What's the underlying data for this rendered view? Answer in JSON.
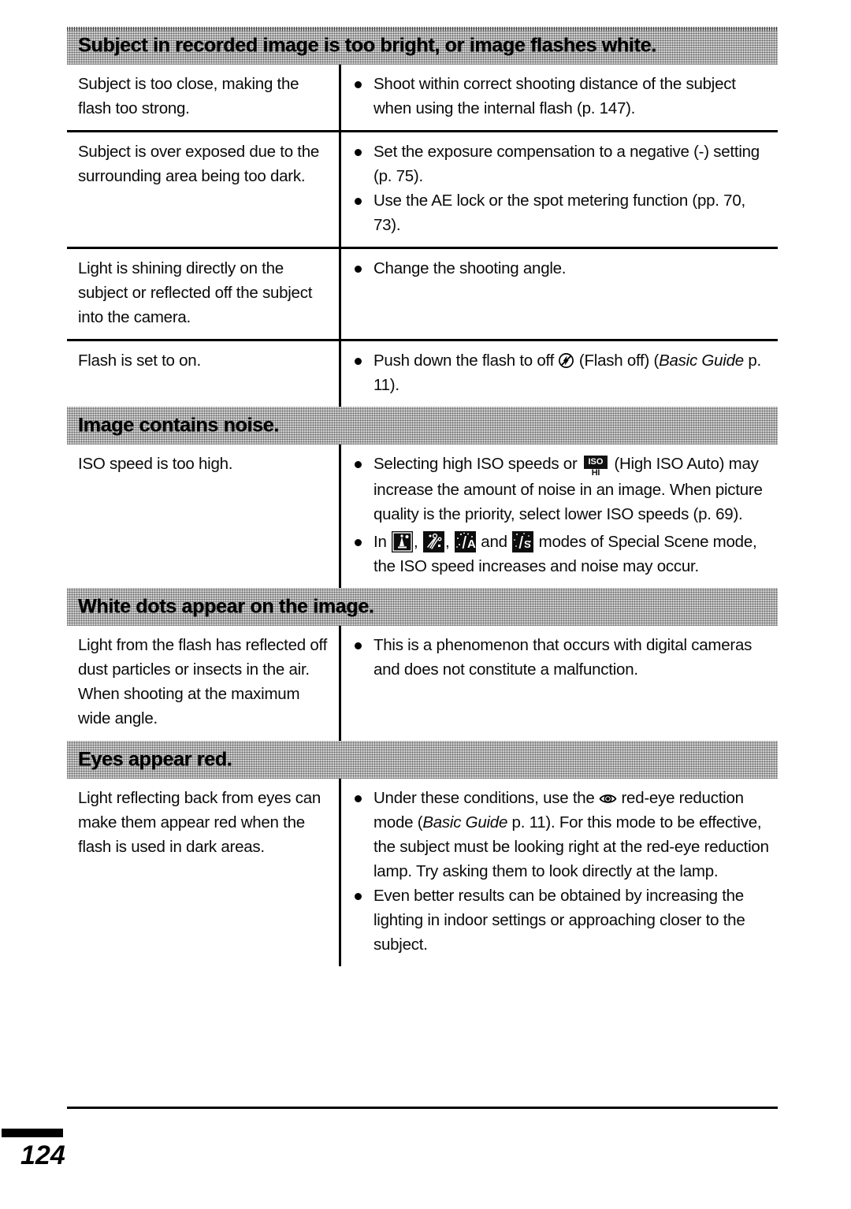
{
  "page": {
    "number": "124"
  },
  "sections": [
    {
      "heading": "Subject in recorded image is too bright, or image flashes white.",
      "rows": [
        {
          "cause": "Subject is too close, making the flash too strong.",
          "remedies": [
            {
              "pre": "Shoot within correct shooting distance of the subject when using the internal flash (p. 147).",
              "icon": null,
              "post": ""
            }
          ]
        },
        {
          "cause": "Subject is over exposed due to the surrounding area being too dark.",
          "remedies": [
            {
              "pre": "Set the exposure compensation to a negative (-) setting (p. 75).",
              "icon": null,
              "post": ""
            },
            {
              "pre": "Use the AE lock or the spot metering function (pp. 70, 73).",
              "icon": null,
              "post": ""
            }
          ]
        },
        {
          "cause": "Light is shining directly on the subject or reflected off the subject into the camera.",
          "remedies": [
            {
              "pre": "Change the shooting angle.",
              "icon": null,
              "post": ""
            }
          ]
        },
        {
          "cause": "Flash is set to on.",
          "remedies": [
            {
              "pre": "Push down the flash to off ",
              "icon": "flash-off-icon",
              "post": " (Flash off) (Basic Guide p. 11).",
              "post_italic": "Basic Guide",
              "post_a": " (Flash off) (",
              "post_b": " p. 11)."
            }
          ]
        }
      ]
    },
    {
      "heading": "Image contains noise.",
      "rows": [
        {
          "cause": "ISO speed is too high.",
          "remedies": [
            {
              "pre": "Selecting high ISO speeds or ",
              "icon": "high-iso-auto-icon",
              "post": " (High ISO Auto) may increase the amount of noise in an image. When picture quality is the priority, select lower ISO speeds (p. 69)."
            },
            {
              "pre": "In ",
              "icons": [
                "night-snapshot-icon",
                "fireworks-icon",
                "indoor-icon",
                "kids-and-pets-icon"
              ],
              "sep1": ", ",
              "sep2": ", ",
              "sep3": " and ",
              "post": " modes of Special Scene mode, the ISO speed increases and noise may occur."
            }
          ]
        }
      ]
    },
    {
      "heading": "White dots appear on the image.",
      "rows": [
        {
          "cause": "Light from the flash has reflected off dust particles or insects in the air. When shooting at the maximum wide angle.",
          "remedies": [
            {
              "pre": "This is a phenomenon that occurs with digital cameras and does not constitute a malfunction.",
              "icon": null,
              "post": ""
            }
          ]
        }
      ]
    },
    {
      "heading": "Eyes appear red.",
      "rows": [
        {
          "cause": "Light reflecting back from eyes can make them appear red when the flash is used in dark areas.",
          "remedies": [
            {
              "pre": "Under these conditions, use the ",
              "icon": "red-eye-icon",
              "post_a": " red-eye reduction mode (",
              "post_italic": "Basic Guide",
              "post_b": " p. 11). For this mode to be effective, the subject must be looking right at the red-eye reduction lamp. Try asking them to look directly at the lamp."
            },
            {
              "pre": "Even better results can be obtained by increasing the lighting in indoor settings or approaching closer to the subject.",
              "icon": null,
              "post": ""
            }
          ]
        }
      ]
    }
  ],
  "icons": {
    "flash_off": "flash-off-icon",
    "high_iso_auto": "high-iso-auto-icon",
    "night_snapshot": "night-snapshot-icon",
    "fireworks": "fireworks-icon",
    "indoor": "indoor-icon",
    "kids_and_pets": "kids-and-pets-icon",
    "red_eye": "red-eye-icon",
    "iso_badge_text": "ISO",
    "iso_hi_text": "HI",
    "indoor_letter": "A",
    "kids_letter": "S"
  },
  "colors": {
    "ink": "#000000",
    "band": "#cfcfcf",
    "paper": "#ffffff"
  }
}
